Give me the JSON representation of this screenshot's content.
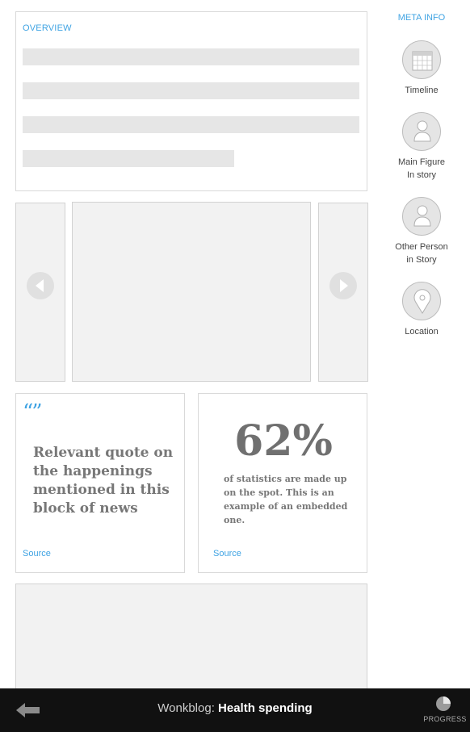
{
  "overview": {
    "heading": "OVERVIEW"
  },
  "quote": {
    "mark": "“”",
    "text": "Relevant quote on the happenings mentioned in this block of news",
    "source": "Source"
  },
  "stat": {
    "number": "62%",
    "text": "of statistics are made up on the spot. This is an example of an embedded one.",
    "source": "Source"
  },
  "meta": {
    "heading": "META INFO",
    "items": [
      {
        "icon": "calendar-icon",
        "label_lines": [
          "Timeline"
        ]
      },
      {
        "icon": "person-icon",
        "label_lines": [
          "Main Figure",
          "In story"
        ]
      },
      {
        "icon": "person-icon",
        "label_lines": [
          "Other Person",
          "in Story"
        ]
      },
      {
        "icon": "location-pin-icon",
        "label_lines": [
          "Location"
        ]
      }
    ]
  },
  "footer": {
    "prefix": "Wonkblog:",
    "title": "Health spending",
    "progress_label": "PROGRESS",
    "progress_fraction": 0.25
  },
  "colors": {
    "accent": "#3fa3e3",
    "footer_bg": "#111111",
    "placeholder": "#e6e6e6"
  }
}
